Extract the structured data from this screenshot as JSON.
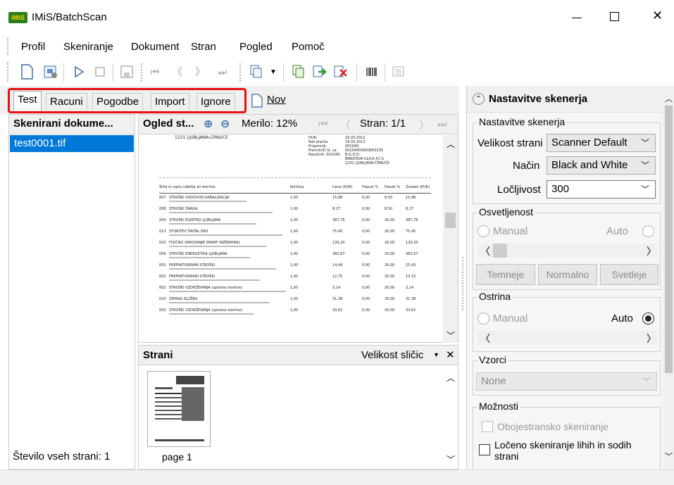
{
  "window": {
    "title": "IMiS/BatchScan",
    "app_icon": "imis-logo"
  },
  "window_controls": {
    "minimize": "minimize-icon",
    "maximize": "maximize-icon",
    "close": "close-icon"
  },
  "menu": [
    "Profil",
    "Skeniranje",
    "Dokument",
    "Stran",
    "Pogled",
    "Pomoč"
  ],
  "toolbar": {
    "icons": [
      "new-document-icon",
      "scan-settings-icon",
      "play-icon",
      "stop-icon",
      "save-icon",
      "first-page-icon",
      "prev-page-icon",
      "next-page-icon",
      "last-page-icon",
      "copy-icon",
      "dropdown-arrow-icon",
      "copy-pages-icon",
      "export-icon",
      "delete-icon",
      "barcode-icon",
      "list-icon"
    ]
  },
  "tabs": [
    "Test",
    "Racuni",
    "Pogodbe",
    "Import",
    "Ignore"
  ],
  "new_button": {
    "label": "Nov"
  },
  "left_panel": {
    "header": "Skenirani dokume...",
    "items": [
      "test0001.tif"
    ],
    "footer": "Število vseh strani: 1"
  },
  "preview": {
    "header": "Ogled st...",
    "zoom_label": "Merilo: 12%",
    "page_label": "Stran: 1/1"
  },
  "document": {
    "header_left": "1231  LJUBLJANA-ČRNUČE",
    "header_fields": [
      [
        "DUR:",
        "16.03.2012"
      ],
      [
        "Rok plačila:",
        "24.03.2012"
      ],
      [
        "Projemnik:",
        "001049"
      ],
      [
        "Plačnik/ID št. za",
        "00104959950663235"
      ],
      [
        "Naročnik: 001049",
        "B.G.O.O."
      ]
    ],
    "address": [
      "BRNIČEVA ULICA 41 G",
      "1231  LJUBLJANA-ČRNUČE"
    ],
    "columns": [
      "Šifra in naziv izdelka ali storitve",
      "Količina",
      "Cena (EUR)",
      "Popust %",
      "Davek %",
      "Znesek (EUR)"
    ],
    "rows": [
      [
        "007",
        "STROŠKI VODOVOD-KANALIZACIJA",
        "1,00",
        "15,88",
        "0,00",
        "8,50",
        "15,88"
      ],
      [
        "008",
        "STROŠKI ŠNAGA",
        "1,00",
        "8,27",
        "0,00",
        "8,50",
        "8,27"
      ],
      [
        "004",
        "STROŠKI ELEKTRO LJUBLJANA",
        "1,00",
        "387,76",
        "0,00",
        "20,00",
        "387,76"
      ],
      [
        "013",
        "STORITEV ŠINTAL EKO",
        "1,00",
        "75,45",
        "0,00",
        "20,00",
        "75,45"
      ],
      [
        "010",
        "FIZIČNO VAROVANJE SMART INŽENIRING",
        "1,00",
        "130,20",
        "0,00",
        "20,00",
        "130,20"
      ],
      [
        "006",
        "STROŠKI ENERGETIKA LJUBLJANA",
        "1,00",
        "382,67",
        "0,00",
        "20,00",
        "382,67"
      ],
      [
        "002",
        "PREFAKTURIRANI STROŠKI",
        "1,00",
        "14,44",
        "0,00",
        "20,00",
        "15,43"
      ],
      [
        "002",
        "PREFAKTURIRANI STROŠKI",
        "1,00",
        "12,75",
        "0,00",
        "20,00",
        "13,15"
      ],
      [
        "002",
        "STROŠKI VZDRŽEVANJA (splošne storitve)",
        "1,00",
        "3,14",
        "0,00",
        "20,00",
        "3,14"
      ],
      [
        "010",
        "ZIMSKA SLUŽBA",
        "1,00",
        "31,38",
        "0,00",
        "20,00",
        "31,38"
      ],
      [
        "002",
        "STROŠKI VZDRŽEVANJA (splošne storitve)",
        "1,00",
        "33,62",
        "0,00",
        "20,00",
        "33,62"
      ]
    ]
  },
  "pages_panel": {
    "header": "Strani",
    "size_label": "Velikost sličic",
    "close": "close-icon",
    "thumb_label": "page 1"
  },
  "right_panel": {
    "header": "Nastavitve skenerja",
    "group_scanner": {
      "legend": "Nastavitve skenerja",
      "page_size_label": "Velikost strani",
      "page_size_value": "Scanner Default",
      "mode_label": "Način",
      "mode_value": "Black and White",
      "resolution_label": "Ločljivost",
      "resolution_value": "300"
    },
    "group_brightness": {
      "legend": "Osvetljenost",
      "manual": "Manual",
      "auto": "Auto",
      "btn_darker": "Temneje",
      "btn_normal": "Normalno",
      "btn_lighter": "Svetleje"
    },
    "group_sharpness": {
      "legend": "Ostrina",
      "manual": "Manual",
      "auto": "Auto"
    },
    "group_templates": {
      "legend": "Vzorci",
      "value": "None"
    },
    "group_options": {
      "legend": "Možnosti",
      "duplex": "Obojestransko skeniranje",
      "split": "Ločeno skeniranje lihih in sodih strani"
    }
  }
}
